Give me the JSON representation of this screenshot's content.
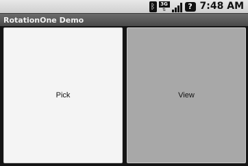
{
  "status_bar": {
    "bluetooth_icon": "bluetooth-icon",
    "network_type": "3G",
    "network_icon": "network-3g-icon",
    "signal_icon": "signal-strength-icon",
    "help_icon": "?",
    "time": "7:48 AM"
  },
  "app": {
    "title": "RotationOne Demo"
  },
  "panes": {
    "pick_label": "Pick",
    "view_label": "View"
  },
  "colors": {
    "pick_background": "#f4f4f4",
    "view_background": "#a8a8a8",
    "title_bar": "#5a5a5a"
  }
}
